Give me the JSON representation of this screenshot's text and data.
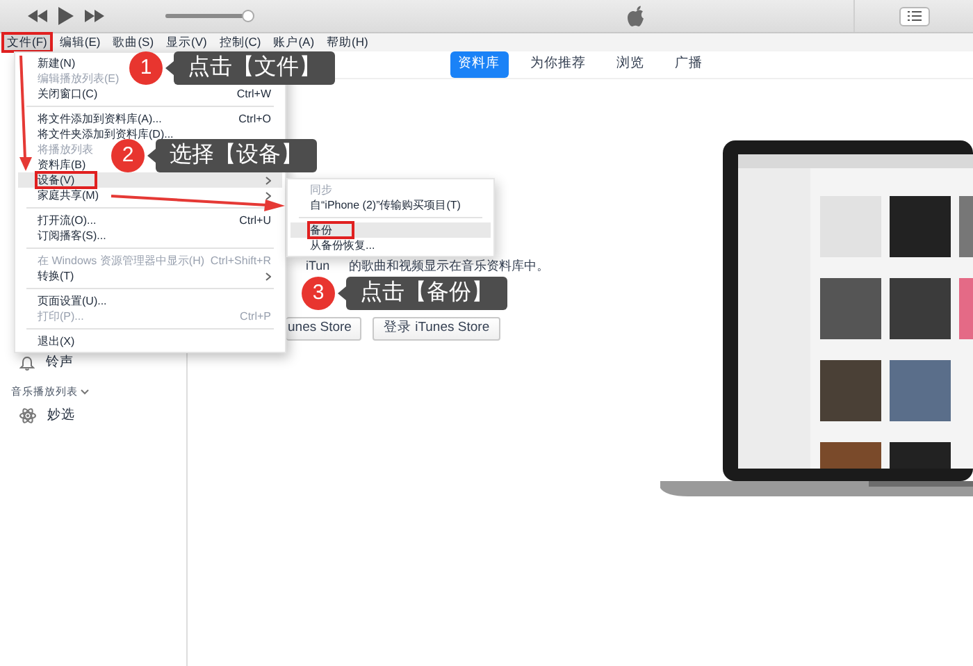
{
  "player": {
    "volume": {
      "level": 0.95
    }
  },
  "menubar": [
    {
      "label": "文件(F)",
      "selected": true,
      "annotated": true
    },
    {
      "label": "编辑(E)",
      "selected": false,
      "annotated": false
    },
    {
      "label": "歌曲(S)",
      "selected": false,
      "annotated": false
    },
    {
      "label": "显示(V)",
      "selected": false,
      "annotated": false
    },
    {
      "label": "控制(C)",
      "selected": false,
      "annotated": false
    },
    {
      "label": "账户(A)",
      "selected": false,
      "annotated": false
    },
    {
      "label": "帮助(H)",
      "selected": false,
      "annotated": false
    }
  ],
  "tabs": [
    {
      "label": "资料库",
      "selected": true
    },
    {
      "label": "为你推荐",
      "selected": false
    },
    {
      "label": "浏览",
      "selected": false
    },
    {
      "label": "广播",
      "selected": false
    }
  ],
  "sidebar": [
    {
      "kind": "item",
      "label": "铃声"
    },
    {
      "kind": "header",
      "label": "音乐播放列表"
    },
    {
      "kind": "item",
      "label": "妙选"
    }
  ],
  "library_hint": [
    "iTun",
    "的歌曲和视频显示在音乐资料库中。"
  ],
  "buttons": [
    "unes Store",
    "登录 iTunes Store"
  ],
  "file_menu": [
    {
      "kind": "item",
      "label": "新建(N)",
      "disabled": false,
      "selected": false,
      "annotated": false
    },
    {
      "kind": "item",
      "label": "编辑播放列表(E)",
      "disabled": true,
      "submenu": false,
      "selected": false,
      "annotated": false
    },
    {
      "kind": "item",
      "label": "关闭窗口(C)",
      "shortcut": "Ctrl+W",
      "disabled": false,
      "submenu": false,
      "selected": false,
      "annotated": false
    },
    {
      "kind": "separator"
    },
    {
      "kind": "item",
      "label": "将文件添加到资料库(A)...",
      "shortcut": "Ctrl+O",
      "disabled": false,
      "submenu": false,
      "selected": false,
      "annotated": false
    },
    {
      "kind": "item",
      "label": "将文件夹添加到资料库(D)...",
      "disabled": false,
      "submenu": false,
      "selected": false,
      "annotated": false
    },
    {
      "kind": "item",
      "label": "将播放列表",
      "disabled": true,
      "submenu": false,
      "selected": false,
      "annotated": false
    },
    {
      "kind": "item",
      "label": "资料库(B)",
      "disabled": false,
      "selected": false,
      "annotated": false
    },
    {
      "kind": "item",
      "label": "设备(V)",
      "disabled": false,
      "submenu": true,
      "selected": true,
      "annotated": true
    },
    {
      "kind": "item",
      "label": "家庭共享(M)",
      "disabled": false,
      "submenu": true,
      "selected": false,
      "annotated": false
    },
    {
      "kind": "separator"
    },
    {
      "kind": "item",
      "label": "打开流(O)...",
      "shortcut": "Ctrl+U",
      "disabled": false,
      "submenu": false,
      "selected": false,
      "annotated": false
    },
    {
      "kind": "item",
      "label": "订阅播客(S)...",
      "disabled": false,
      "submenu": false,
      "selected": false,
      "annotated": false
    },
    {
      "kind": "separator"
    },
    {
      "kind": "item",
      "label": "在 Windows 资源管理器中显示(H)",
      "shortcut": "Ctrl+Shift+R",
      "disabled": true,
      "submenu": false,
      "selected": false,
      "annotated": false
    },
    {
      "kind": "item",
      "label": "转换(T)",
      "disabled": false,
      "submenu": true,
      "selected": false,
      "annotated": false
    },
    {
      "kind": "separator"
    },
    {
      "kind": "item",
      "label": "页面设置(U)...",
      "disabled": false,
      "submenu": false,
      "selected": false,
      "annotated": false
    },
    {
      "kind": "item",
      "label": "打印(P)...",
      "shortcut": "Ctrl+P",
      "disabled": true,
      "submenu": false,
      "selected": false,
      "annotated": false
    },
    {
      "kind": "separator"
    },
    {
      "kind": "item",
      "label": "退出(X)",
      "disabled": false,
      "submenu": false,
      "selected": false,
      "annotated": false
    }
  ],
  "device_submenu": [
    {
      "kind": "item",
      "label": "同步",
      "disabled": true,
      "selected": false,
      "annotated": false
    },
    {
      "kind": "item",
      "label": "自“iPhone (2)”传输购买项目(T)",
      "disabled": false,
      "selected": false,
      "annotated": false
    },
    {
      "kind": "separator"
    },
    {
      "kind": "item",
      "label": "备份",
      "disabled": false,
      "selected": true,
      "annotated": true
    },
    {
      "kind": "item",
      "label": "从备份恢复...",
      "disabled": false,
      "selected": false,
      "annotated": false
    }
  ],
  "callouts": [
    {
      "number": "1",
      "text": "点击【文件】"
    },
    {
      "number": "2",
      "text": "选择【设备】"
    },
    {
      "number": "3",
      "text": "点击【备份】"
    }
  ]
}
